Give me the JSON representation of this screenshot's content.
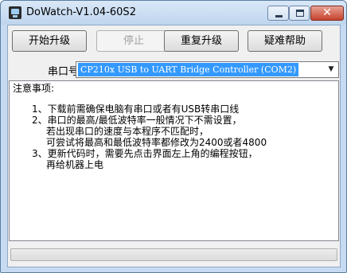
{
  "window": {
    "title": "DoWatch-V1.04-60S2",
    "close_glyph": "✕"
  },
  "toolbar": {
    "start_upgrade": "开始升级",
    "stop": "停止",
    "retry_upgrade": "重复升级",
    "help": "疑难帮助"
  },
  "port": {
    "label": "串口号",
    "selected": "CP210x USB to UART Bridge Controller (COM2)",
    "arrow": "▼"
  },
  "notes": {
    "title": "注意事项:",
    "lines": [
      "1、下载前需确保电脑有串口或者有USB转串口线",
      "2、串口的最高/最低波特率一般情况下不需设置，",
      "若出现串口的速度与本程序不匹配时，",
      "可尝试将最高和最低波特率都修改为2400或者4800",
      "3、更新代码时，需要先点击界面左上角的编程按钮，",
      "再给机器上电"
    ]
  },
  "progress": {
    "value": 0
  },
  "icons": {
    "app": "app-icon",
    "minimize": "minimize-icon",
    "maximize": "maximize-icon",
    "close": "close-icon",
    "dropdown": "chevron-down-icon"
  }
}
